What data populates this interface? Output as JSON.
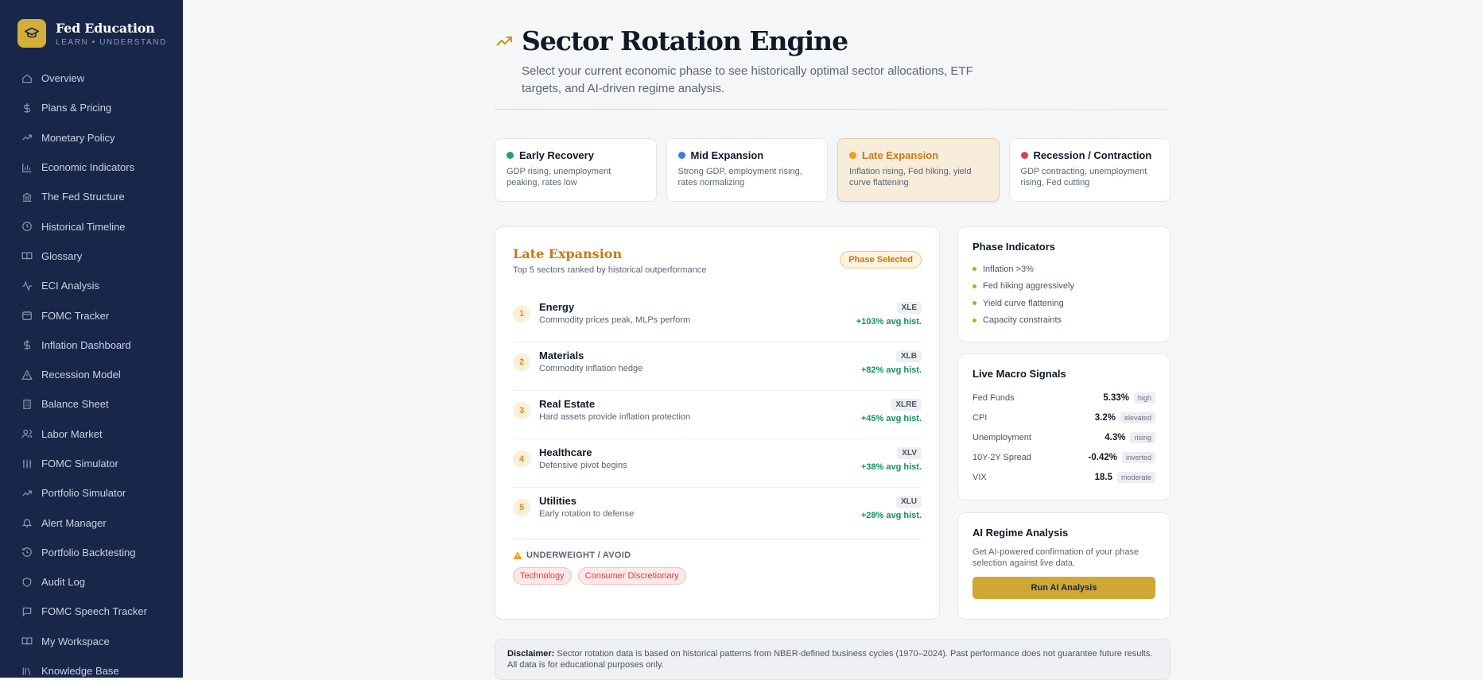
{
  "brand": {
    "name": "Fed Education",
    "tagline": "LEARN • UNDERSTAND"
  },
  "sidebar": {
    "items": [
      {
        "label": "Overview",
        "icon": "home-icon"
      },
      {
        "label": "Plans & Pricing",
        "icon": "dollar-icon"
      },
      {
        "label": "Monetary Policy",
        "icon": "trend-up-icon"
      },
      {
        "label": "Economic Indicators",
        "icon": "bar-chart-icon"
      },
      {
        "label": "The Fed Structure",
        "icon": "bank-icon"
      },
      {
        "label": "Historical Timeline",
        "icon": "clock-icon"
      },
      {
        "label": "Glossary",
        "icon": "book-icon"
      },
      {
        "label": "ECI Analysis",
        "icon": "pulse-icon"
      },
      {
        "label": "FOMC Tracker",
        "icon": "calendar-icon"
      },
      {
        "label": "Inflation Dashboard",
        "icon": "dollar-icon"
      },
      {
        "label": "Recession Model",
        "icon": "warning-icon"
      },
      {
        "label": "Balance Sheet",
        "icon": "building-icon"
      },
      {
        "label": "Labor Market",
        "icon": "users-icon"
      },
      {
        "label": "FOMC Simulator",
        "icon": "sliders-icon"
      },
      {
        "label": "Portfolio Simulator",
        "icon": "trend-up-icon"
      },
      {
        "label": "Alert Manager",
        "icon": "bell-icon"
      },
      {
        "label": "Portfolio Backtesting",
        "icon": "history-icon"
      },
      {
        "label": "Audit Log",
        "icon": "shield-icon"
      },
      {
        "label": "FOMC Speech Tracker",
        "icon": "chat-icon"
      },
      {
        "label": "My Workspace",
        "icon": "book-icon"
      },
      {
        "label": "Knowledge Base",
        "icon": "library-icon"
      }
    ]
  },
  "header": {
    "title": "Sector Rotation Engine",
    "subtitle": "Select your current economic phase to see historically optimal sector allocations, ETF targets, and AI-driven regime analysis."
  },
  "phases": [
    {
      "name": "Early Recovery",
      "desc": "GDP rising, unemployment peaking, rates low",
      "color": "#1fa36b"
    },
    {
      "name": "Mid Expansion",
      "desc": "Strong GDP, employment rising, rates normalizing",
      "color": "#3b7be0"
    },
    {
      "name": "Late Expansion",
      "desc": "Inflation rising, Fed hiking, yield curve flattening",
      "color": "#e8a21b"
    },
    {
      "name": "Recession / Contraction",
      "desc": "GDP contracting, unemployment rising, Fed cutting",
      "color": "#dc4444"
    }
  ],
  "selected_phase": {
    "title": "Late Expansion",
    "subtitle": "Top 5 sectors ranked by historical outperformance",
    "badge": "Phase Selected",
    "sectors": [
      {
        "rank": "1",
        "name": "Energy",
        "note": "Commodity prices peak, MLPs perform",
        "ticker": "XLE",
        "perf": "+103% avg hist."
      },
      {
        "rank": "2",
        "name": "Materials",
        "note": "Commodity inflation hedge",
        "ticker": "XLB",
        "perf": "+82% avg hist."
      },
      {
        "rank": "3",
        "name": "Real Estate",
        "note": "Hard assets provide inflation protection",
        "ticker": "XLRE",
        "perf": "+45% avg hist."
      },
      {
        "rank": "4",
        "name": "Healthcare",
        "note": "Defensive pivot begins",
        "ticker": "XLV",
        "perf": "+38% avg hist."
      },
      {
        "rank": "5",
        "name": "Utilities",
        "note": "Early rotation to defense",
        "ticker": "XLU",
        "perf": "+28% avg hist."
      }
    ],
    "avoid_title": "UNDERWEIGHT / AVOID",
    "avoid": [
      "Technology",
      "Consumer Discretionary"
    ]
  },
  "indicators": {
    "title": "Phase Indicators",
    "items": [
      "Inflation >3%",
      "Fed hiking aggressively",
      "Yield curve flattening",
      "Capacity constraints"
    ]
  },
  "signals": {
    "title": "Live Macro Signals",
    "rows": [
      {
        "label": "Fed Funds",
        "value": "5.33%",
        "tag": "high"
      },
      {
        "label": "CPI",
        "value": "3.2%",
        "tag": "elevated"
      },
      {
        "label": "Unemployment",
        "value": "4.3%",
        "tag": "rising"
      },
      {
        "label": "10Y-2Y Spread",
        "value": "-0.42%",
        "tag": "inverted"
      },
      {
        "label": "VIX",
        "value": "18.5",
        "tag": "moderate"
      }
    ]
  },
  "ai": {
    "title": "AI Regime Analysis",
    "desc": "Get AI-powered confirmation of your phase selection against live data.",
    "button": "Run AI Analysis"
  },
  "disclaimer": {
    "label": "Disclaimer:",
    "text": "Sector rotation data is based on historical patterns from NBER-defined business cycles (1970–2024). Past performance does not guarantee future results. All data is for educational purposes only."
  }
}
